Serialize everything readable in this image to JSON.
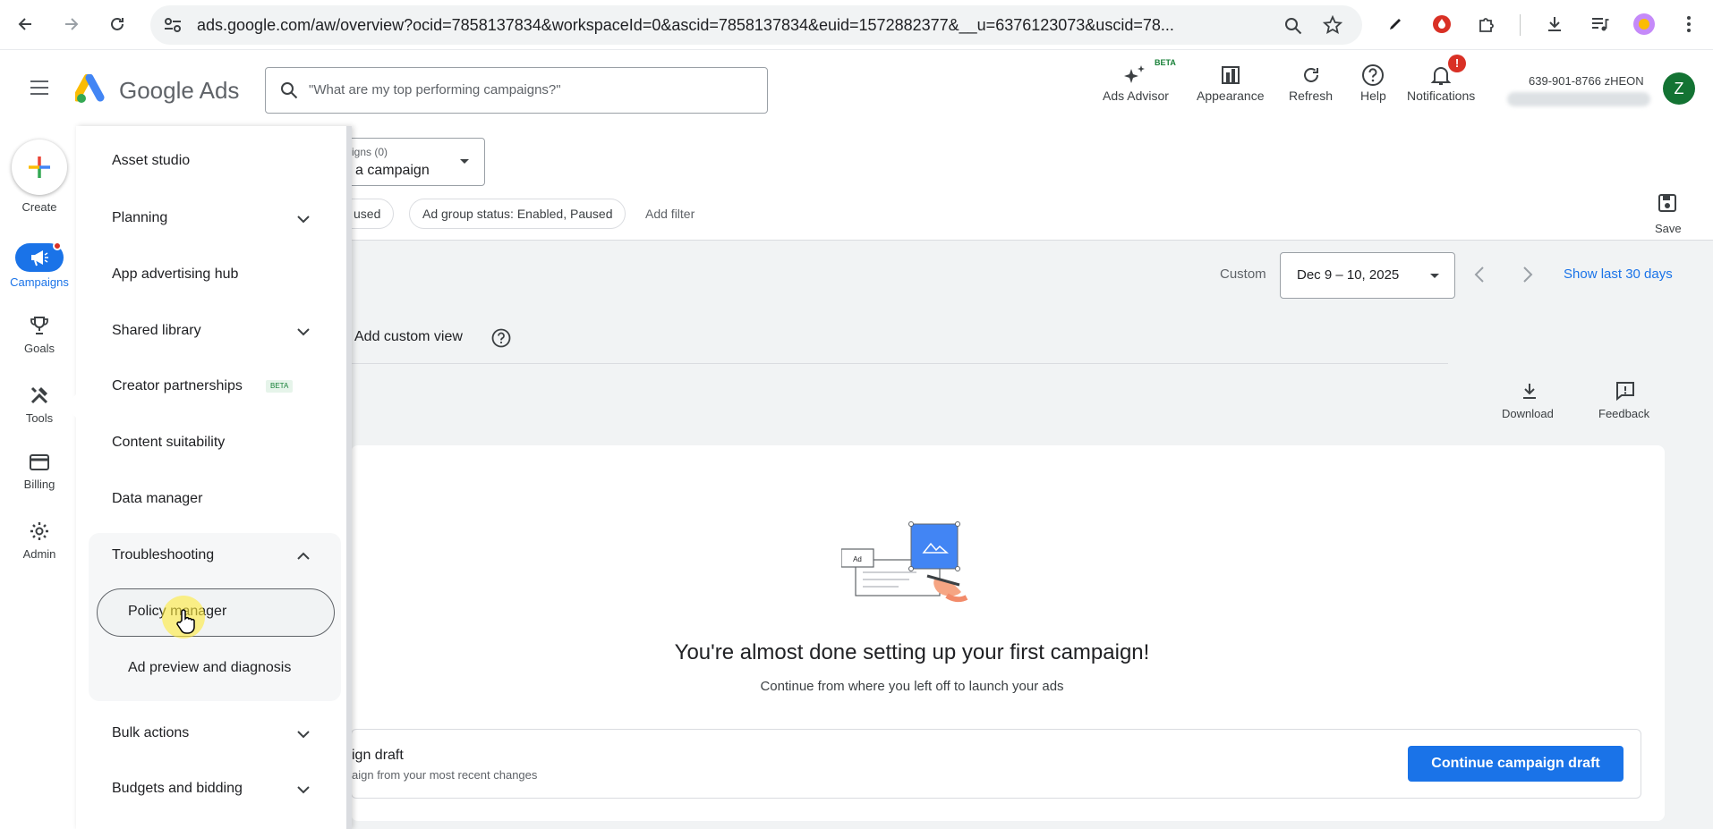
{
  "browser": {
    "url": "ads.google.com/aw/overview?ocid=7858137834&workspaceId=0&ascid=7858137834&euid=1572882377&__u=6376123073&uscid=78..."
  },
  "header": {
    "logo_text": "Google Ads",
    "search_placeholder": "\"What are my top performing campaigns?\"",
    "tools": [
      {
        "label": "Ads Advisor",
        "badge": "BETA"
      },
      {
        "label": "Appearance"
      },
      {
        "label": "Refresh"
      },
      {
        "label": "Help"
      },
      {
        "label": "Notifications",
        "badge": "!"
      }
    ],
    "account_id": "639-901-8766 zHEON",
    "avatar_letter": "Z"
  },
  "rail": {
    "items": [
      {
        "label": "Create"
      },
      {
        "label": "Campaigns"
      },
      {
        "label": "Goals"
      },
      {
        "label": "Tools"
      },
      {
        "label": "Billing"
      },
      {
        "label": "Admin"
      }
    ]
  },
  "menu": {
    "items": [
      {
        "label": "Asset studio"
      },
      {
        "label": "Planning"
      },
      {
        "label": "App advertising hub"
      },
      {
        "label": "Shared library"
      },
      {
        "label": "Creator partnerships",
        "badge": "BETA"
      },
      {
        "label": "Content suitability"
      },
      {
        "label": "Data manager"
      },
      {
        "label": "Troubleshooting"
      },
      {
        "label": "Policy manager"
      },
      {
        "label": "Ad preview and diagnosis"
      },
      {
        "label": "Bulk actions"
      },
      {
        "label": "Budgets and bidding"
      }
    ]
  },
  "main": {
    "campaign_select_count": "igns (0)",
    "campaign_select_value": "a campaign",
    "filter_chip_1": "used",
    "filter_chip_2": "Ad group status: Enabled, Paused",
    "add_filter": "Add filter",
    "save_label": "Save",
    "date_mode": "Custom",
    "date_range": "Dec 9 – 10, 2025",
    "show_last": "Show last 30 days",
    "add_custom_view": "Add custom view",
    "download_label": "Download",
    "feedback_label": "Feedback",
    "illustration_ad_label": "Ad",
    "card_title": "You're almost done setting up your first campaign!",
    "card_subtitle": "Continue from where you left off to launch your ads",
    "draft_title": "ign draft",
    "draft_subtitle": "aign from your most recent changes",
    "continue_button": "Continue campaign draft"
  },
  "colors": {
    "accent": "#1a73e8",
    "notification": "#d93025",
    "avatar": "#137333"
  }
}
